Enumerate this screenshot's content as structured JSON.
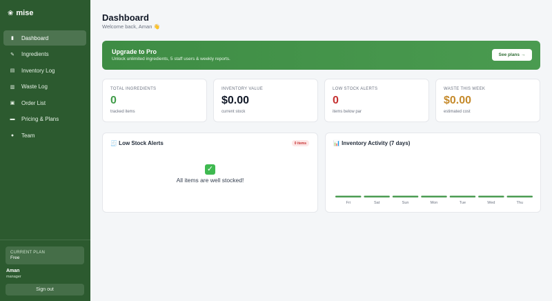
{
  "brand": {
    "logo_icon": "herb-icon",
    "name": "mise"
  },
  "sidebar": {
    "items": [
      {
        "label": "Dashboard",
        "icon": "dashboard-icon",
        "glyph": "▮",
        "active": true
      },
      {
        "label": "Ingredients",
        "icon": "leaf-icon",
        "glyph": "✎",
        "active": false
      },
      {
        "label": "Inventory Log",
        "icon": "clipboard-icon",
        "glyph": "▤",
        "active": false
      },
      {
        "label": "Waste Log",
        "icon": "trash-icon",
        "glyph": "▥",
        "active": false
      },
      {
        "label": "Order List",
        "icon": "box-icon",
        "glyph": "▣",
        "active": false
      },
      {
        "label": "Pricing & Plans",
        "icon": "card-icon",
        "glyph": "▬",
        "active": false
      },
      {
        "label": "Team",
        "icon": "people-icon",
        "glyph": "●",
        "active": false
      }
    ],
    "plan_label": "CURRENT PLAN",
    "plan_value": "Free",
    "user_name": "Aman",
    "user_role": "manager",
    "signout_label": "Sign out"
  },
  "header": {
    "title": "Dashboard",
    "subtitle": "Welcome back, Aman 👋"
  },
  "banner": {
    "title": "Upgrade to Pro",
    "text": "Unlock unlimited ingredients, 5 staff users & weekly reports.",
    "button_label": "See plans →"
  },
  "stats": [
    {
      "label": "TOTAL INGREDIENTS",
      "value": "0",
      "sub": "tracked items",
      "color": "#3f9b48"
    },
    {
      "label": "INVENTORY VALUE",
      "value": "$0.00",
      "sub": "current stock",
      "color": "#111827"
    },
    {
      "label": "LOW STOCK ALERTS",
      "value": "0",
      "sub": "items below par",
      "color": "#c53030"
    },
    {
      "label": "WASTE THIS WEEK",
      "value": "$0.00",
      "sub": "estimated cost",
      "color": "#c58a2b"
    }
  ],
  "low_stock": {
    "title": "🧾 Low Stock Alerts",
    "badge": "0 items",
    "ok_icon": "check-icon",
    "message": "All items are well stocked!"
  },
  "activity": {
    "title": "📊 Inventory Activity (7 days)",
    "bar_color": "#4a9b50"
  },
  "chart_data": {
    "type": "bar",
    "title": "Inventory Activity (7 days)",
    "categories": [
      "Fri",
      "Sat",
      "Sun",
      "Mon",
      "Tue",
      "Wed",
      "Thu"
    ],
    "values": [
      0,
      0,
      0,
      0,
      0,
      0,
      0
    ],
    "xlabel": "",
    "ylabel": "",
    "grid": false
  }
}
